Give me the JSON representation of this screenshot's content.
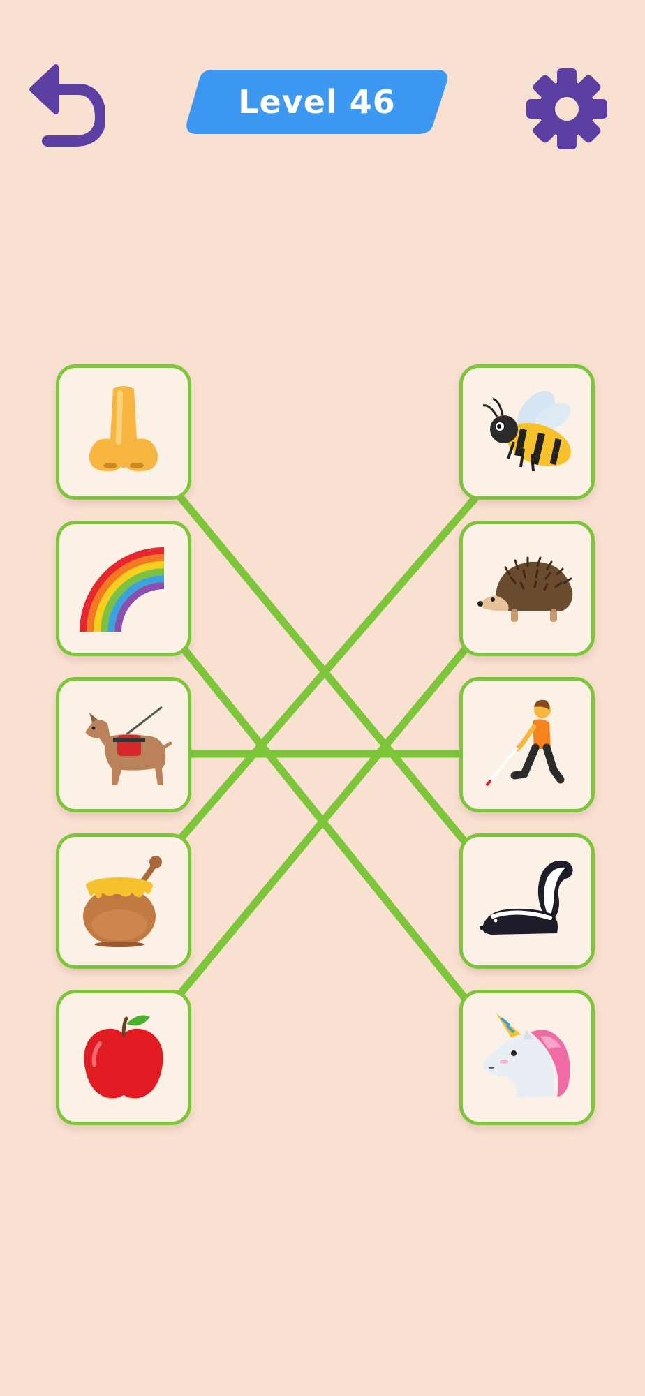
{
  "header": {
    "level_label": "Level 46",
    "undo_icon": "undo-arrow-icon",
    "settings_icon": "gear-icon"
  },
  "colors": {
    "background": "#f8e1d1",
    "card_fill": "#fcf1e6",
    "card_border": "#7dc63a",
    "connection_line": "#7dc63a",
    "level_pill": "#3d98f2",
    "icon_purple": "#5b3fa2"
  },
  "left_items": [
    {
      "icon": "nose-icon"
    },
    {
      "icon": "rainbow-icon"
    },
    {
      "icon": "guide-dog-icon"
    },
    {
      "icon": "honey-pot-icon"
    },
    {
      "icon": "red-apple-icon"
    }
  ],
  "right_items": [
    {
      "icon": "bee-icon"
    },
    {
      "icon": "hedgehog-icon"
    },
    {
      "icon": "person-with-white-cane-icon"
    },
    {
      "icon": "skunk-icon"
    },
    {
      "icon": "unicorn-icon"
    }
  ],
  "connections": [
    {
      "from": "nose",
      "to": "skunk"
    },
    {
      "from": "rainbow",
      "to": "unicorn"
    },
    {
      "from": "guide-dog",
      "to": "person-with-white-cane"
    },
    {
      "from": "honey-pot",
      "to": "bee"
    },
    {
      "from": "red-apple",
      "to": "hedgehog"
    }
  ]
}
